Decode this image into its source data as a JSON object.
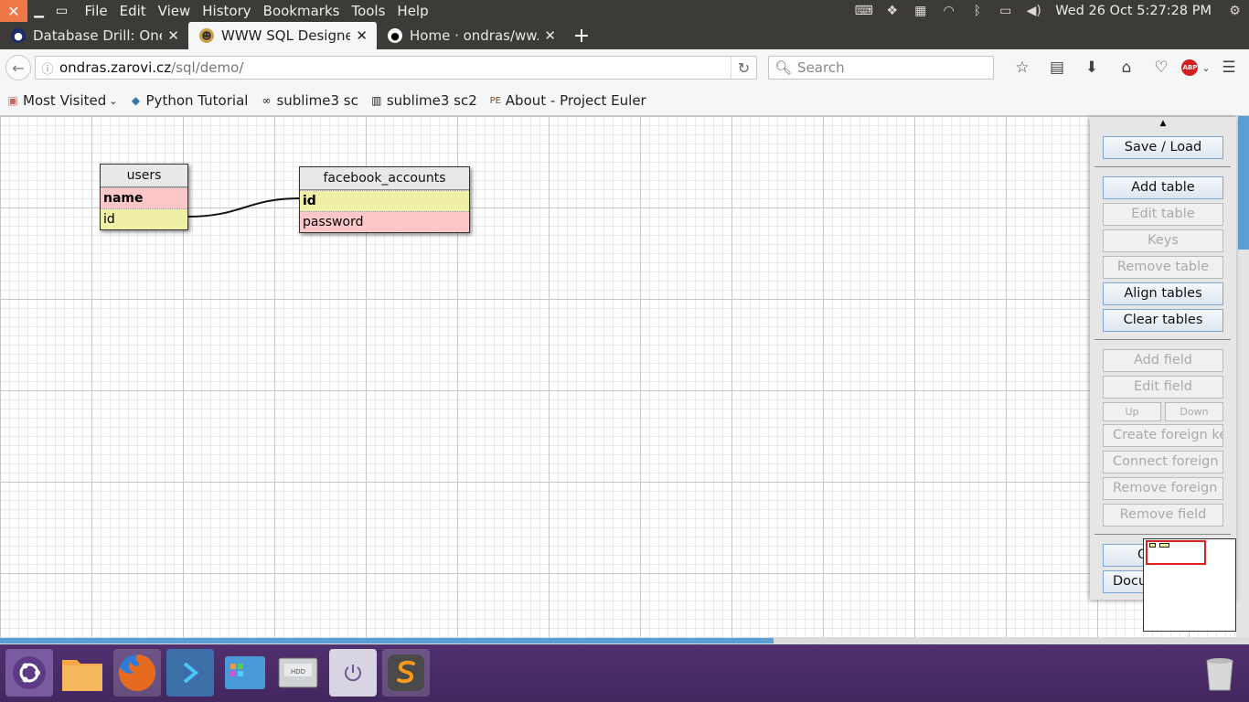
{
  "system": {
    "menu": [
      "File",
      "Edit",
      "View",
      "History",
      "Bookmarks",
      "Tools",
      "Help"
    ],
    "clock": "Wed 26 Oct  5:27:28 PM"
  },
  "tabs": [
    {
      "title": "Database Drill: One ...",
      "active": false
    },
    {
      "title": "WWW SQL Designer",
      "active": true
    },
    {
      "title": "Home · ondras/ww...",
      "active": false
    }
  ],
  "navbar": {
    "url_domain": "ondras.zarovi.cz",
    "url_path": "/sql/demo/",
    "search_placeholder": "Search",
    "abp_label": "ABP"
  },
  "bookmarks": [
    "Most Visited",
    "Python Tutorial",
    "sublime3 sc",
    "sublime3 sc2",
    "About - Project Euler"
  ],
  "tables": [
    {
      "name": "users",
      "fields": [
        {
          "name": "name",
          "pk": true,
          "color": "pink"
        },
        {
          "name": "id",
          "pk": false,
          "color": "yellow"
        }
      ]
    },
    {
      "name": "facebook_accounts",
      "fields": [
        {
          "name": "id",
          "pk": true,
          "color": "yellow"
        },
        {
          "name": "password",
          "pk": false,
          "color": "pink"
        }
      ]
    }
  ],
  "panel": {
    "save_load": "Save / Load",
    "add_table": "Add table",
    "edit_table": "Edit table",
    "keys": "Keys",
    "remove_table": "Remove table",
    "align_tables": "Align tables",
    "clear_tables": "Clear tables",
    "add_field": "Add field",
    "edit_field": "Edit field",
    "up": "Up",
    "down": "Down",
    "create_fk": "Create foreign key",
    "connect_fk": "Connect foreign key",
    "remove_fk": "Remove foreign key",
    "remove_field": "Remove field",
    "options": "Options",
    "documentation": "Documentation"
  },
  "colors": {
    "pink": "#fbc7c9",
    "yellow": "#efefa6",
    "accent": "#5a9fd4"
  }
}
